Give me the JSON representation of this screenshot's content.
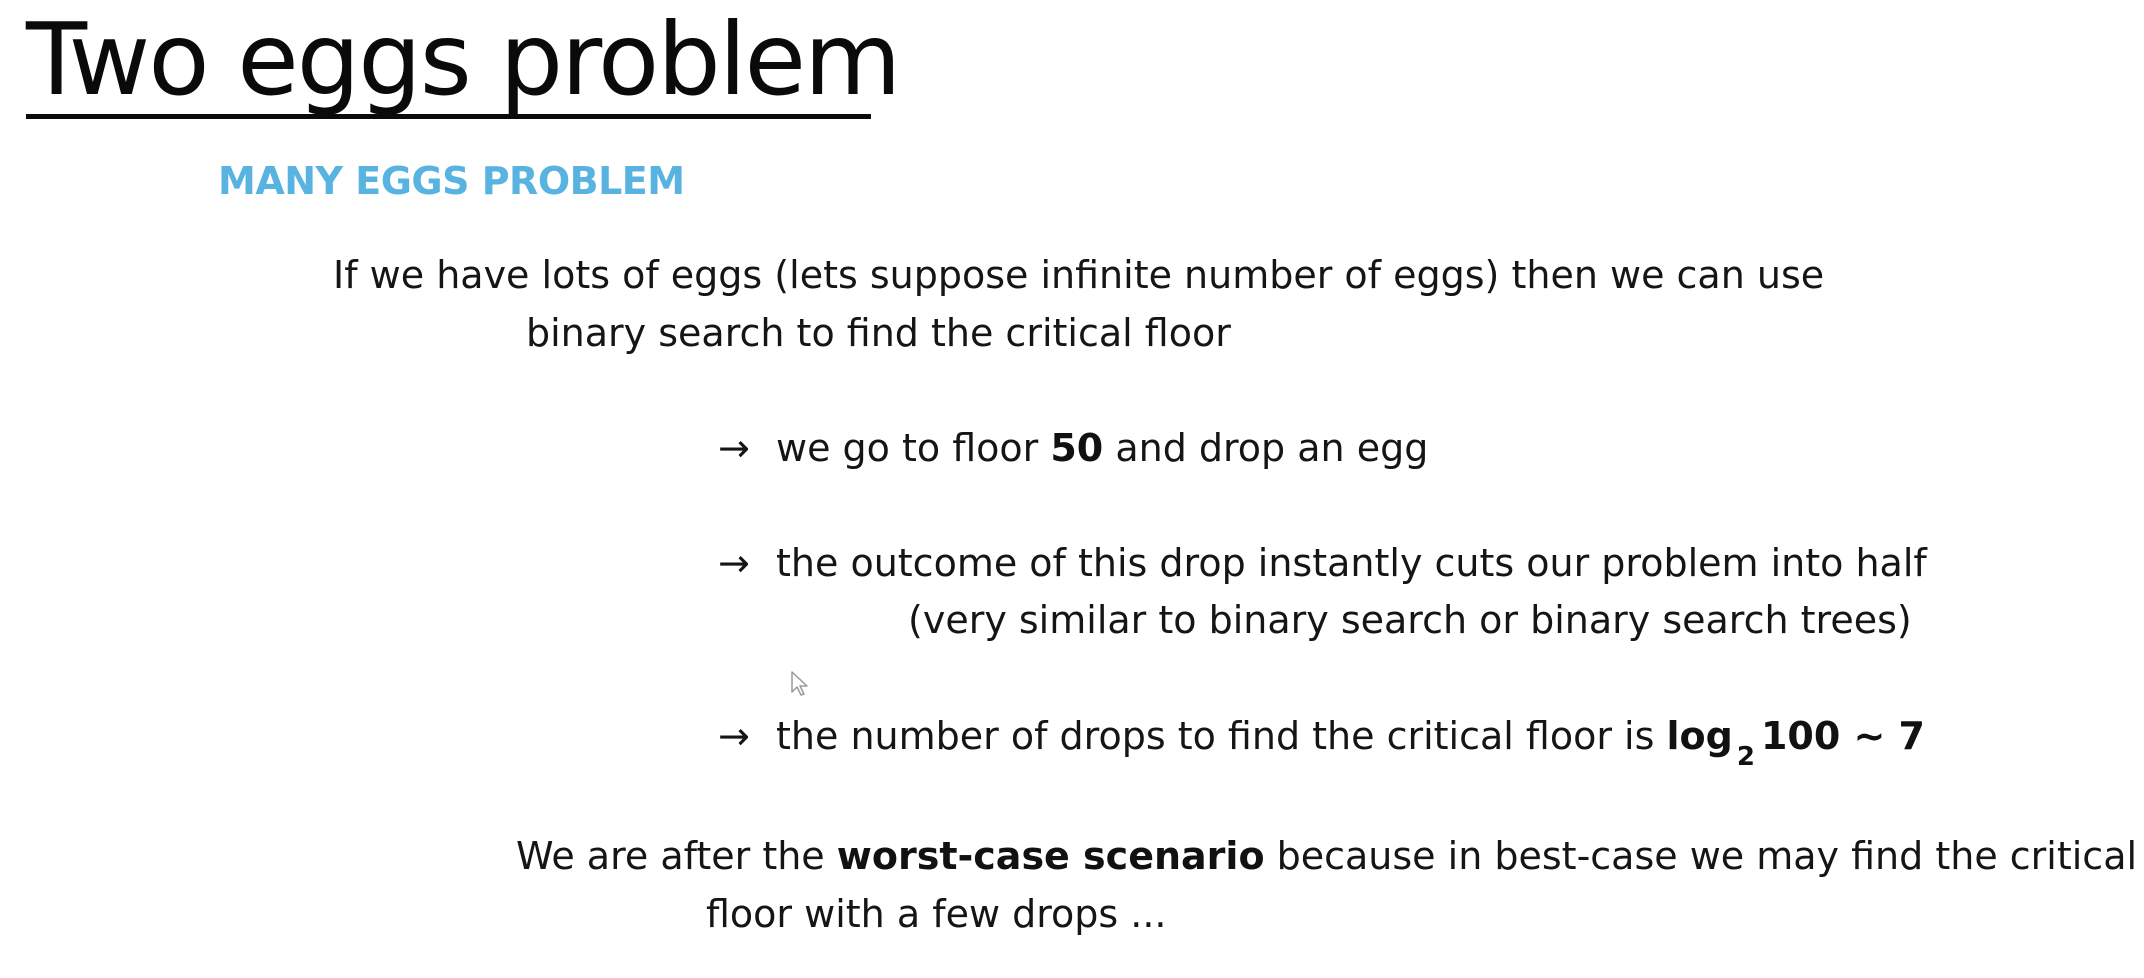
{
  "slide": {
    "title": "Two eggs problem",
    "subtitle": "MANY EGGS PROBLEM",
    "intro_line1": "If we have lots of eggs (lets suppose infinite number of eggs) then we can use",
    "intro_line2": "binary search to find the critical floor",
    "arrow_symbol": "→",
    "bullet1_pre": "we go to floor ",
    "bullet1_bold": "50",
    "bullet1_post": " and drop an egg",
    "bullet2_line1": "the outcome of this drop instantly cuts our problem into half",
    "bullet2_line2": "(very similar to binary search or binary search trees)",
    "bullet3_pre": "the number of drops to find the critical floor is ",
    "bullet3_log": "log",
    "bullet3_base": "2",
    "bullet3_rest": "100 ~ 7",
    "closing_pre": "We are after the ",
    "closing_bold": "worst-case scenario",
    "closing_post": " because in best-case we may find the critical",
    "closing_line2": "floor with a few drops ..."
  }
}
